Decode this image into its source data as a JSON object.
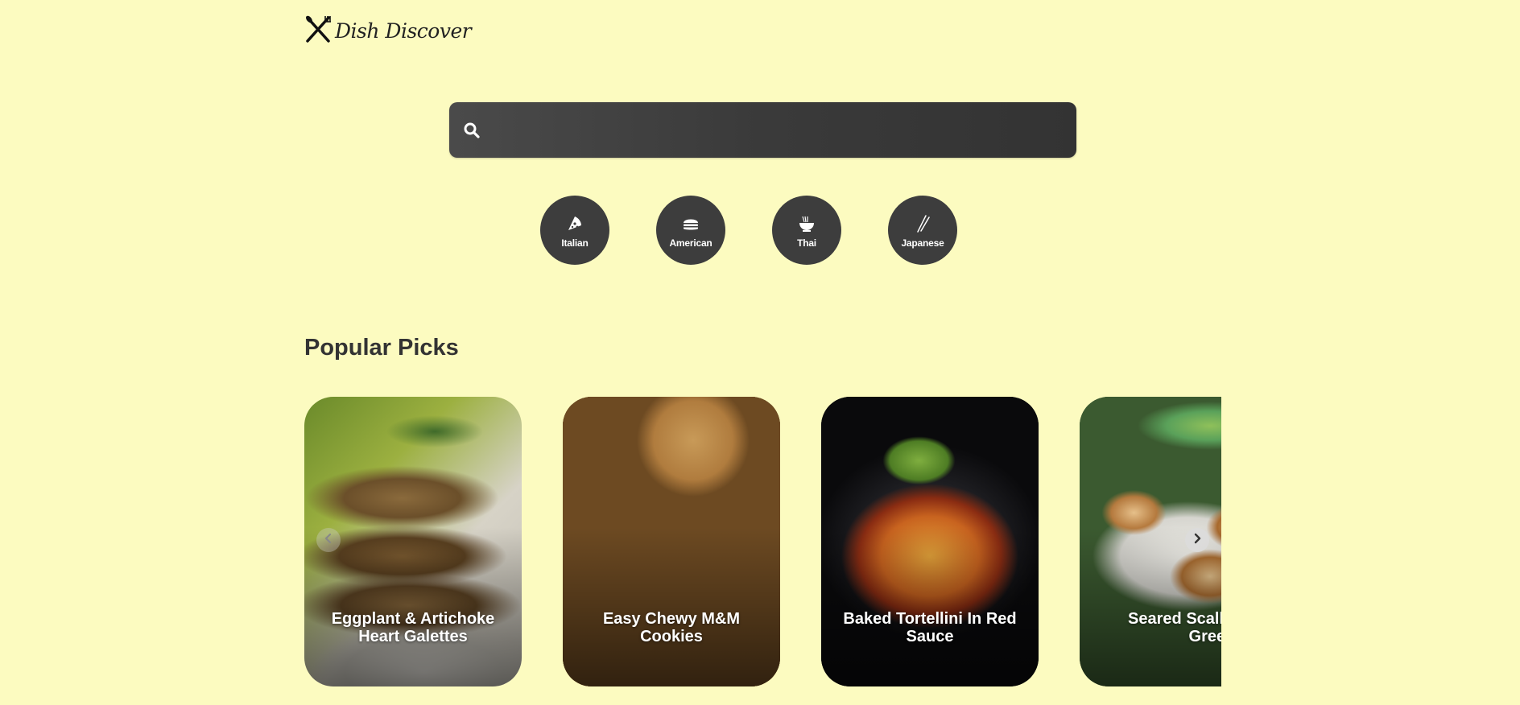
{
  "brand": {
    "name": "Dish Discover",
    "logo_icon": "crossed-fork-knife-icon"
  },
  "search": {
    "value": "",
    "placeholder": "",
    "icon": "search-icon"
  },
  "categories": [
    {
      "label": "Italian",
      "icon": "pizza-icon"
    },
    {
      "label": "American",
      "icon": "burger-icon"
    },
    {
      "label": "Thai",
      "icon": "noodle-bowl-icon"
    },
    {
      "label": "Japanese",
      "icon": "chopsticks-icon"
    }
  ],
  "popular": {
    "title": "Popular Picks",
    "cards": [
      {
        "title": "Eggplant & Artichoke Heart Galettes"
      },
      {
        "title": "Easy Chewy M&M Cookies"
      },
      {
        "title": "Baked Tortellini In Red Sauce"
      },
      {
        "title": "Seared Scallops Wilted Greens"
      }
    ],
    "prev_icon": "chevron-left-icon",
    "next_icon": "chevron-right-icon"
  },
  "colors": {
    "background": "#fcfbc0",
    "search_bg": "#3d3d3d",
    "category_bg": "#3d3d3d",
    "heading": "#333333",
    "text_on_dark": "#ffffff"
  }
}
